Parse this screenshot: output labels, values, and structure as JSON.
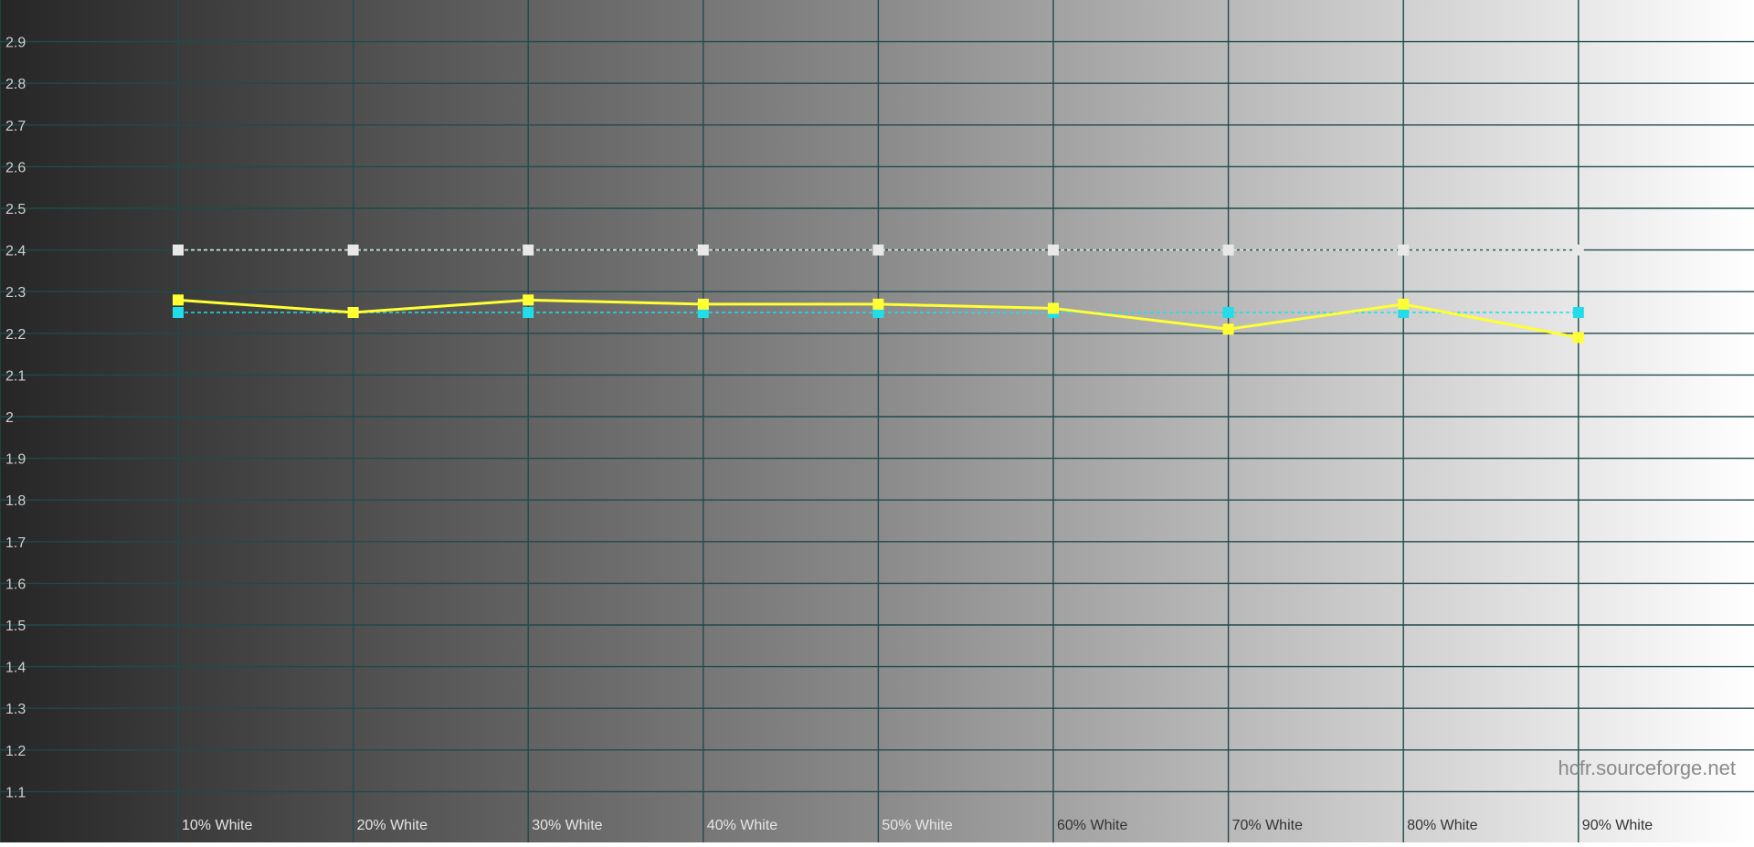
{
  "chart_data": {
    "type": "line",
    "title": "",
    "xlabel": "",
    "ylabel": "",
    "categories": [
      "10% White",
      "20% White",
      "30% White",
      "40% White",
      "50% White",
      "60% White",
      "70% White",
      "80% White",
      "90% White"
    ],
    "ylim": [
      1.0,
      3.0
    ],
    "yticks": [
      "1.1",
      "1.2",
      "1.3",
      "1.4",
      "1.5",
      "1.6",
      "1.7",
      "1.8",
      "1.9",
      "2",
      "2.1",
      "2.2",
      "2.3",
      "2.4",
      "2.5",
      "2.6",
      "2.7",
      "2.8",
      "2.9"
    ],
    "grid": true,
    "background": "grayscale gradient from dark to white",
    "series": [
      {
        "values": [
          2.28,
          2.25,
          2.28,
          2.27,
          2.27,
          2.26,
          2.21,
          2.27,
          2.19
        ],
        "color": "#ffff33",
        "style": "solid"
      },
      {
        "values": [
          2.25,
          2.25,
          2.25,
          2.25,
          2.25,
          2.25,
          2.25,
          2.25,
          2.25
        ],
        "color": "#22dde8",
        "style": "dashed"
      },
      {
        "values": [
          2.4,
          2.4,
          2.4,
          2.4,
          2.4,
          2.4,
          2.4,
          2.4,
          2.4
        ],
        "color": "#e8e8e8",
        "style": "dashed"
      }
    ],
    "watermark": "hcfr.sourceforge.net",
    "colors": {
      "grid": "#1f4b4b",
      "ytick_label": "#cfcfcf"
    }
  }
}
